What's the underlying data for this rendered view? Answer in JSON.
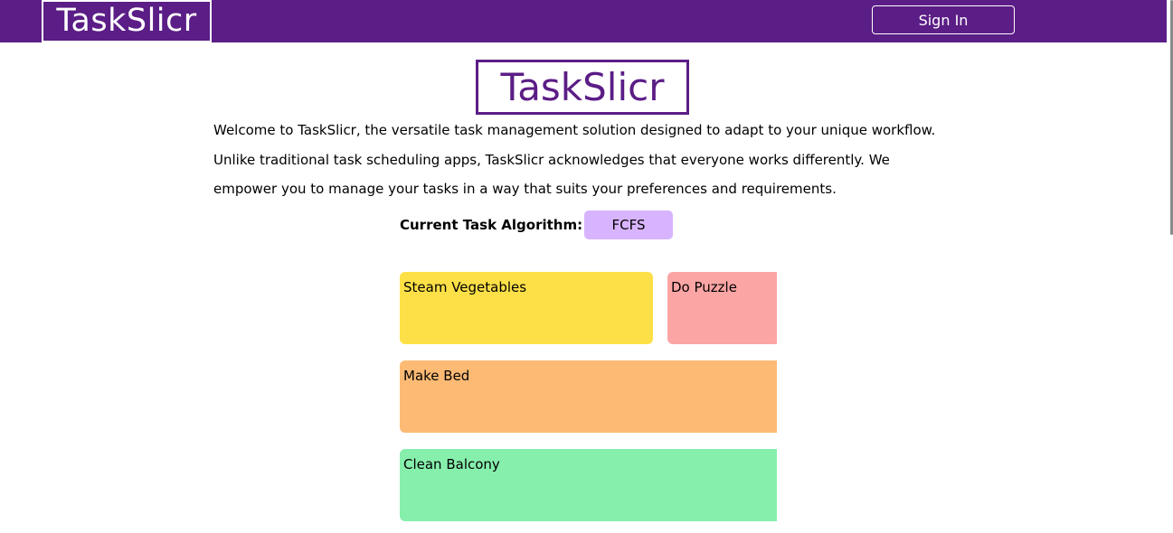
{
  "header": {
    "logo_text": "TaskSlicr",
    "signin_label": "Sign In",
    "brand_color": "#5b1d86"
  },
  "main": {
    "logo_text": "TaskSlicr",
    "intro": "Welcome to TaskSlicr, the versatile task management solution designed to adapt to your unique workflow. Unlike traditional task scheduling apps, TaskSlicr acknowledges that everyone works differently. We empower you to manage your tasks in a way that suits your preferences and requirements.",
    "algorithm_label": "Current Task Algorithm:",
    "algorithm_value": "FCFS",
    "algorithm_color": "#d8b4fe"
  },
  "tasks": [
    {
      "label": "Steam Vegetables",
      "color": "#fde047"
    },
    {
      "label": "Do Puzzle",
      "color": "#fca5a5"
    },
    {
      "label": "Make Bed",
      "color": "#fdba74"
    },
    {
      "label": "Clean Balcony",
      "color": "#86efac"
    }
  ]
}
